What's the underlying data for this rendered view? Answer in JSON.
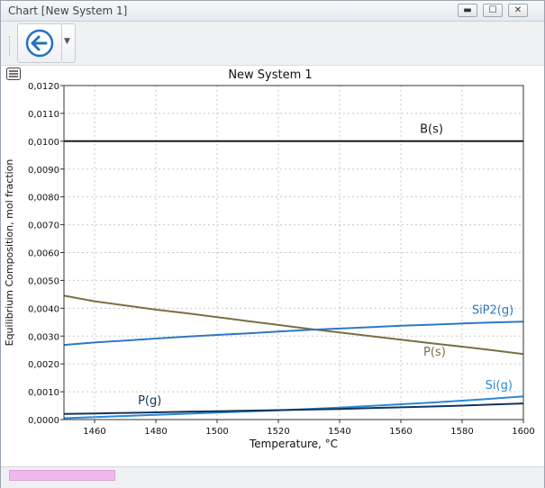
{
  "window": {
    "title": "Chart [New System 1]",
    "controls": {
      "minimize": "▬",
      "maximize": "☐",
      "close": "✕"
    }
  },
  "toolbar": {
    "back_icon": "arrow-left-circle-icon",
    "dropdown_icon": "chevron-down-icon"
  },
  "chart_data": {
    "type": "line",
    "title": "New System 1",
    "xlabel": "Temperature, °C",
    "ylabel": "Equilibrium Composition, mol fraction",
    "xlim": [
      1450,
      1600
    ],
    "ylim": [
      0,
      0.012
    ],
    "xticks": [
      1460,
      1480,
      1500,
      1520,
      1540,
      1560,
      1580,
      1600
    ],
    "yticks": [
      "0,0000",
      "0,0010",
      "0,0020",
      "0,0030",
      "0,0040",
      "0,0050",
      "0,0060",
      "0,0070",
      "0,0080",
      "0,0090",
      "0,0100",
      "0,0110",
      "0,0120"
    ],
    "grid": true,
    "series": [
      {
        "name": "B(s)",
        "color": "#1a1a1a",
        "x": [
          1450,
          1600
        ],
        "y": [
          0.01,
          0.01
        ],
        "label_at": [
          1570,
          0.0103
        ]
      },
      {
        "name": "P(s)",
        "color": "#7a6f44",
        "x": [
          1450,
          1460,
          1470,
          1480,
          1490,
          1500,
          1510,
          1520,
          1530,
          1540,
          1550,
          1560,
          1570,
          1580,
          1590,
          1600
        ],
        "y": [
          0.00445,
          0.00425,
          0.0041,
          0.00395,
          0.00382,
          0.00368,
          0.00354,
          0.0034,
          0.00326,
          0.00313,
          0.003,
          0.00287,
          0.00274,
          0.00262,
          0.00249,
          0.00235
        ],
        "label_at": [
          1571,
          0.0023
        ]
      },
      {
        "name": "SiP2(g)",
        "color": "#2f78c4",
        "x": [
          1450,
          1460,
          1470,
          1480,
          1490,
          1500,
          1510,
          1520,
          1530,
          1540,
          1550,
          1560,
          1570,
          1580,
          1590,
          1600
        ],
        "y": [
          0.00268,
          0.00277,
          0.00284,
          0.00291,
          0.00298,
          0.00304,
          0.0031,
          0.00316,
          0.00322,
          0.00327,
          0.00332,
          0.00337,
          0.00341,
          0.00345,
          0.00349,
          0.00352
        ],
        "label_at": [
          1590,
          0.0038
        ]
      },
      {
        "name": "Si(g)",
        "color": "#2a8ad6",
        "x": [
          1450,
          1460,
          1470,
          1480,
          1490,
          1500,
          1510,
          1520,
          1530,
          1540,
          1550,
          1560,
          1570,
          1580,
          1590,
          1600
        ],
        "y": [
          5e-05,
          9e-05,
          0.00013,
          0.00017,
          0.00021,
          0.00025,
          0.00029,
          0.00033,
          0.00038,
          0.00043,
          0.00049,
          0.00055,
          0.00061,
          0.00068,
          0.00075,
          0.00083
        ],
        "label_at": [
          1592,
          0.0011
        ]
      },
      {
        "name": "P(g)",
        "color": "#14345a",
        "x": [
          1450,
          1460,
          1470,
          1480,
          1490,
          1500,
          1510,
          1520,
          1530,
          1540,
          1550,
          1560,
          1570,
          1580,
          1590,
          1600
        ],
        "y": [
          0.0002,
          0.00022,
          0.00024,
          0.00026,
          0.00028,
          0.0003,
          0.00032,
          0.00034,
          0.00036,
          0.00038,
          0.00041,
          0.00044,
          0.00047,
          0.0005,
          0.00054,
          0.00058
        ],
        "label_at": [
          1478,
          0.00055
        ]
      }
    ]
  },
  "status": {
    "progress": 1.0
  }
}
